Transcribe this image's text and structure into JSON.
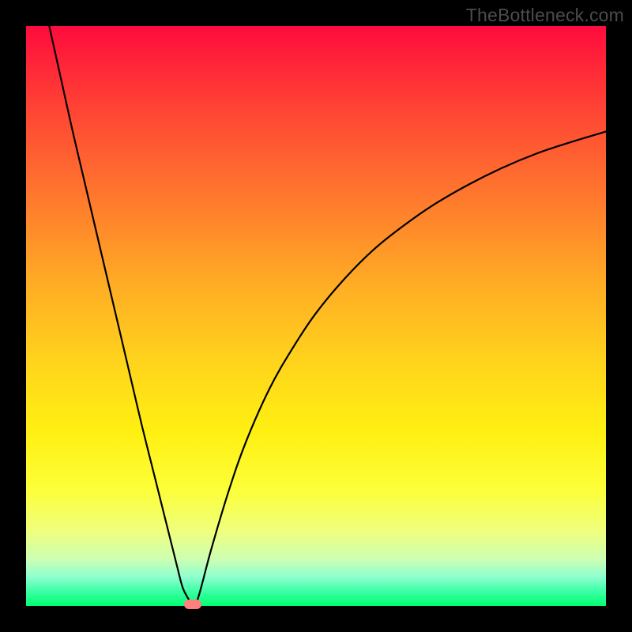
{
  "watermark": "TheBottleneck.com",
  "chart_data": {
    "type": "line",
    "title": "",
    "xlabel": "",
    "ylabel": "",
    "xlim": [
      0,
      100
    ],
    "ylim": [
      0,
      100
    ],
    "x": [
      4,
      6,
      8,
      10,
      12,
      14,
      16,
      18,
      20,
      22,
      24,
      26,
      27,
      28,
      28.5,
      29.2,
      30,
      32,
      35,
      38,
      42,
      46,
      50,
      55,
      60,
      65,
      70,
      76,
      82,
      88,
      94,
      100
    ],
    "values": [
      100,
      91,
      82,
      73.5,
      65,
      56.5,
      48,
      39.5,
      31,
      23,
      15,
      7,
      3.2,
      1.2,
      0.3,
      0.3,
      2.5,
      10,
      20,
      28.5,
      37.5,
      44.5,
      50.5,
      56.5,
      61.5,
      65.5,
      69,
      72.5,
      75.5,
      78,
      80,
      81.8
    ],
    "minimum_marker": {
      "x": 28.8,
      "y": 0.3
    },
    "gradient_stops": [
      {
        "pos": 0.0,
        "color": "#ff0b3e"
      },
      {
        "pos": 0.3,
        "color": "#ff7a2d"
      },
      {
        "pos": 0.58,
        "color": "#ffd41c"
      },
      {
        "pos": 0.8,
        "color": "#fcff39"
      },
      {
        "pos": 0.95,
        "color": "#8dffce"
      },
      {
        "pos": 1.0,
        "color": "#00ff6e"
      }
    ]
  }
}
